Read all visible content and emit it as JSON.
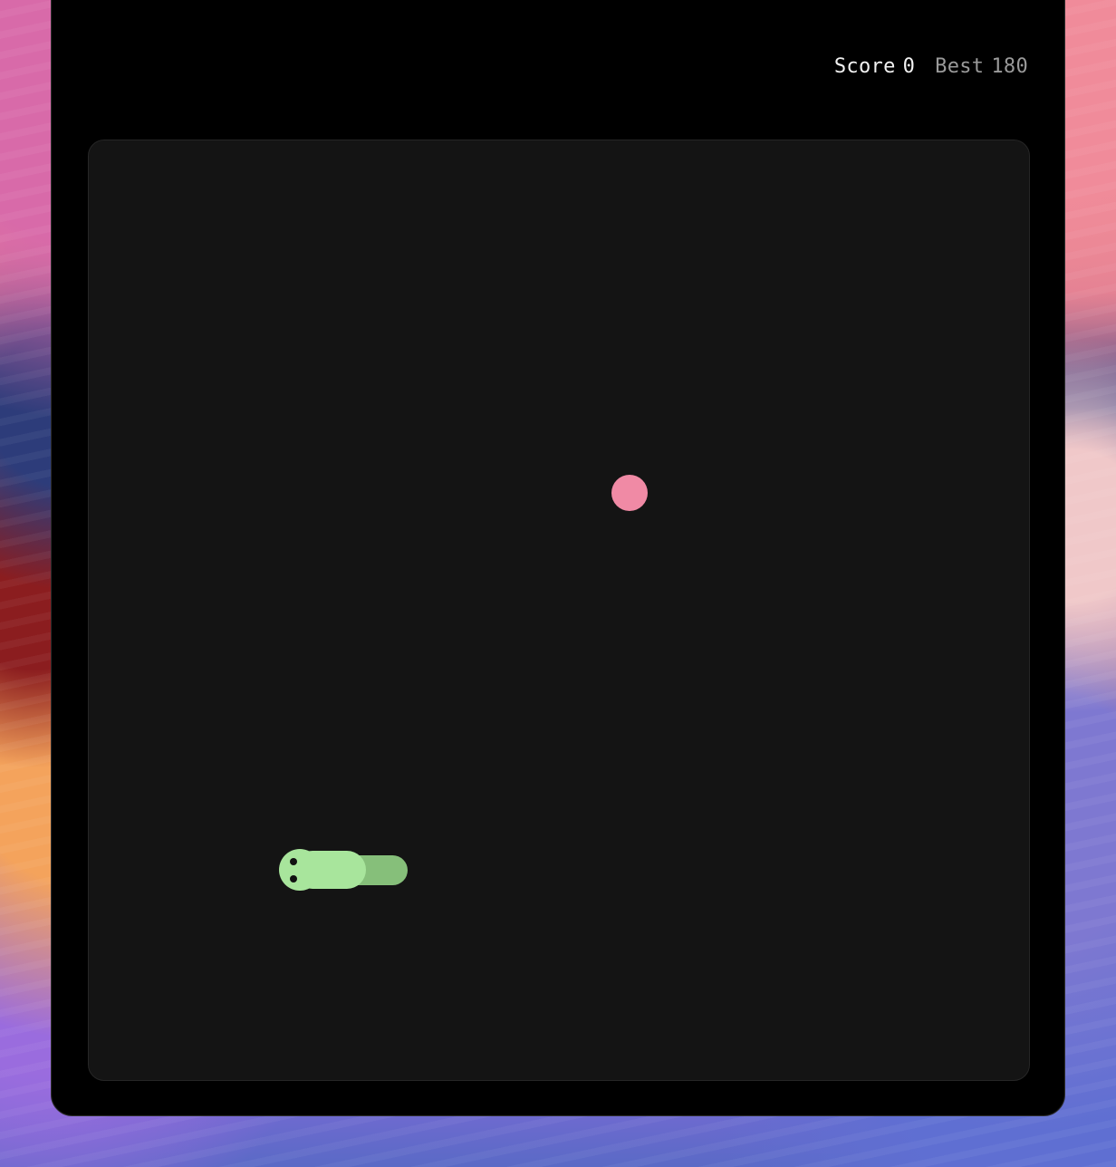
{
  "game": {
    "score_label": "Score",
    "score_value": "0",
    "best_label": "Best",
    "best_value": "180"
  },
  "colors": {
    "window_background": "#000000",
    "board_background": "#141414",
    "food": "#f08aa5",
    "snake_head": "#a8e59c",
    "snake_tail": "#86bf7a",
    "score_text": "#f2f2f2",
    "best_text": "#9a9a9a"
  },
  "icons": {
    "food": "food-dot-icon",
    "snake": "snake-icon"
  }
}
